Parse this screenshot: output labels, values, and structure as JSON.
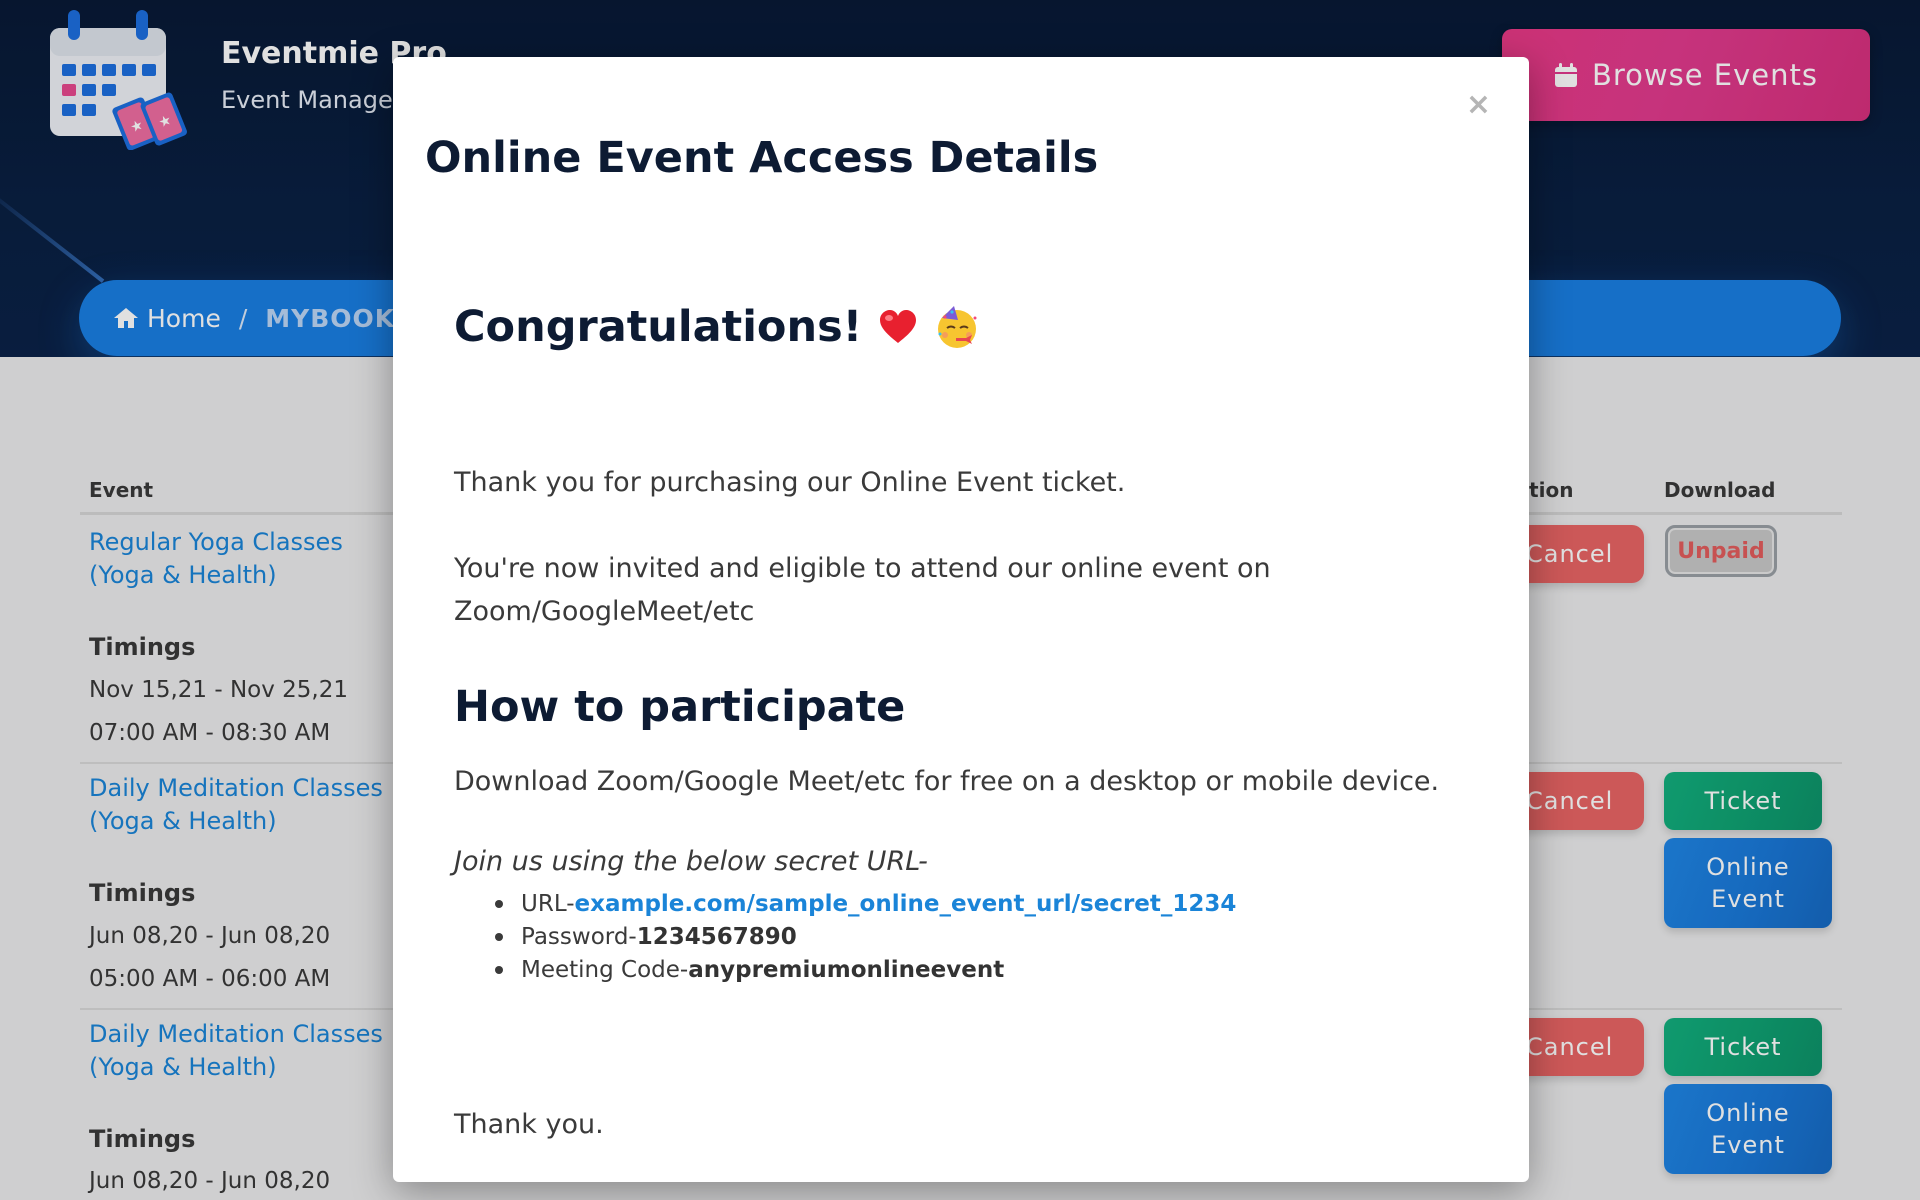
{
  "header": {
    "brand_name": "Eventmie Pro",
    "brand_sub": "Event Management",
    "browse_label": "Browse Events"
  },
  "breadcrumb": {
    "home": "Home",
    "separator": "/",
    "current": "MYBOOKINGS"
  },
  "table": {
    "headers": {
      "event": "Event",
      "cancellation": "Cancellation",
      "download": "Download"
    },
    "rows": [
      {
        "event": "Regular Yoga Classes",
        "category": "(Yoga & Health)",
        "timings_label": "Timings",
        "dates": "Nov 15,21 - Nov 25,21",
        "times": "07:00 AM - 08:30 AM",
        "cancel": "Cancel",
        "download": "Unpaid"
      },
      {
        "event": "Daily Meditation Classes",
        "category": "(Yoga & Health)",
        "timings_label": "Timings",
        "dates": "Jun 08,20 - Jun 08,20",
        "times": "05:00 AM - 06:00 AM",
        "cancel": "Cancel",
        "ticket": "Ticket",
        "online": "Online Event"
      },
      {
        "event": "Daily Meditation Classes",
        "category": "(Yoga & Health)",
        "timings_label": "Timings",
        "dates": "Jun 08,20 - Jun 08,20",
        "cancel": "Cancel",
        "ticket": "Ticket",
        "online": "Online Event"
      }
    ]
  },
  "modal": {
    "close": "×",
    "title": "Online Event Access Details",
    "congrats": "Congratulations!",
    "thank_purchase": "Thank you for purchasing our Online Event ticket.",
    "invited_line1": "You're now invited and eligible to attend our online event on",
    "invited_line2": "Zoom/GoogleMeet/etc",
    "how_title": "How to participate",
    "download_text": "Download Zoom/Google Meet/etc for free on a desktop or mobile device.",
    "join_text": "Join us using the below secret URL-",
    "url_label": "URL- ",
    "url_value": "example.com/sample_online_event_url/secret_1234",
    "password_label": "Password- ",
    "password_value": "1234567890",
    "code_label": "Meeting Code- ",
    "code_value": "anypremiumonlineevent",
    "thanks": "Thank you."
  },
  "colors": {
    "header_bg": "#0a2043",
    "accent_pink": "#e23b8e",
    "accent_blue": "#1a7fe3",
    "link": "#1a84d8",
    "cancel_red": "#e96565",
    "ticket_green": "#0fa373"
  },
  "icons": [
    "calendar-logo-icon",
    "calendar-icon",
    "home-icon",
    "close-icon",
    "heart-icon",
    "party-face-icon"
  ]
}
